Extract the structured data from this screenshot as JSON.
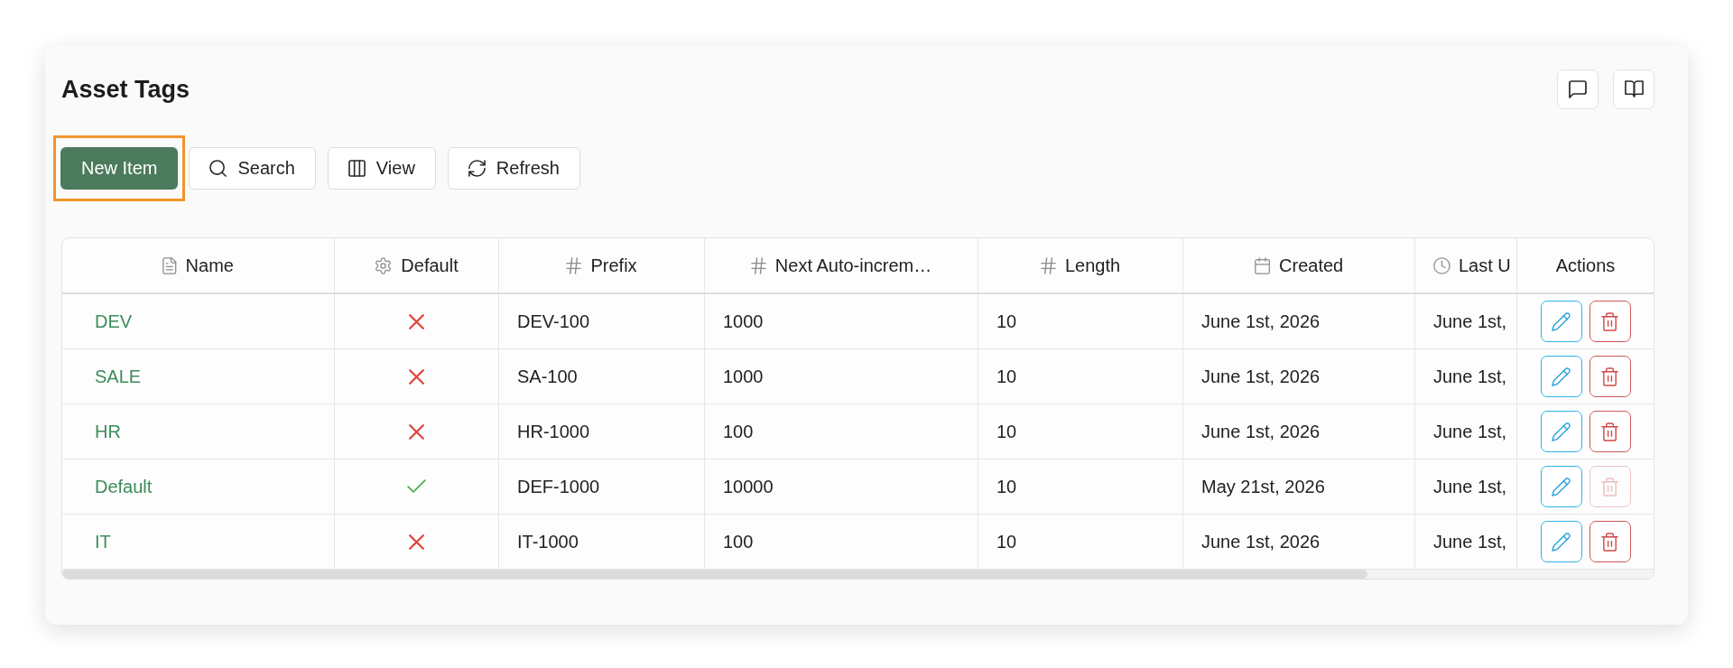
{
  "page": {
    "title": "Asset Tags"
  },
  "toolbar": [
    {
      "label": "New Item",
      "kind": "primary",
      "highlighted": true
    },
    {
      "label": "Search",
      "kind": "outline",
      "highlighted": false
    },
    {
      "label": "View",
      "kind": "outline",
      "highlighted": false
    },
    {
      "label": "Refresh",
      "kind": "outline",
      "highlighted": false
    }
  ],
  "table": {
    "columns": [
      {
        "label": "Name"
      },
      {
        "label": "Default"
      },
      {
        "label": "Prefix"
      },
      {
        "label": "Next Auto-increm…"
      },
      {
        "label": "Length"
      },
      {
        "label": "Created"
      },
      {
        "label": "Last U"
      },
      {
        "label": "Actions"
      }
    ],
    "rows": [
      {
        "name": "DEV",
        "default": false,
        "cells": [
          "DEV-100",
          "1000",
          "10",
          "June 1st, 2026",
          "June 1st,"
        ],
        "delete_disabled": false
      },
      {
        "name": "SALE",
        "default": false,
        "cells": [
          "SA-100",
          "1000",
          "10",
          "June 1st, 2026",
          "June 1st,"
        ],
        "delete_disabled": false
      },
      {
        "name": "HR",
        "default": false,
        "cells": [
          "HR-1000",
          "100",
          "10",
          "June 1st, 2026",
          "June 1st,"
        ],
        "delete_disabled": false
      },
      {
        "name": "Default",
        "default": true,
        "cells": [
          "DEF-1000",
          "10000",
          "10",
          "May 21st, 2026",
          "June 1st,"
        ],
        "delete_disabled": true
      },
      {
        "name": "IT",
        "default": false,
        "cells": [
          "IT-1000",
          "100",
          "10",
          "June 1st, 2026",
          "June 1st,"
        ],
        "delete_disabled": false
      }
    ]
  }
}
